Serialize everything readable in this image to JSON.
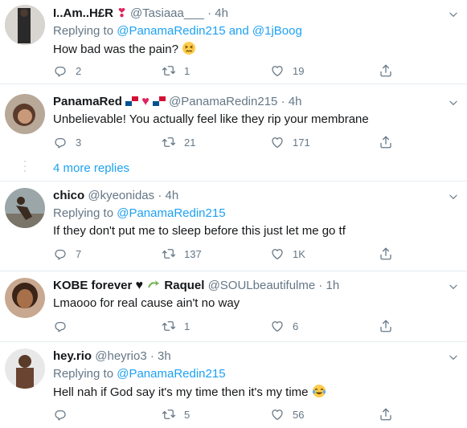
{
  "tweets": [
    {
      "name": "I..Am..H£R",
      "handle": "@Tasiaaa___",
      "time": "4h",
      "replying_prefix": "Replying to",
      "replying_to": "@PanamaRedin215 and @1jBoog",
      "text": "How bad was the pain?",
      "replies": "2",
      "retweets": "1",
      "likes": "19"
    },
    {
      "name": "PanamaRed",
      "handle": "@PanamaRedin215",
      "time": "4h",
      "text": "Unbelievable! You actually feel like they rip your membrane",
      "replies": "3",
      "retweets": "21",
      "likes": "171"
    },
    {
      "name": "chico",
      "handle": "@kyeonidas",
      "time": "4h",
      "replying_prefix": "Replying to",
      "replying_to": "@PanamaRedin215",
      "text": "If they don't put me to sleep before this just let me go tf",
      "replies": "7",
      "retweets": "137",
      "likes": "1K"
    },
    {
      "name_a": "KOBE forever",
      "name_b": "Raquel",
      "handle": "@SOULbeautifulme",
      "time": "1h",
      "text": "Lmaooo for real cause ain't no way",
      "replies": "",
      "retweets": "1",
      "likes": "6"
    },
    {
      "name": "hey.rio",
      "handle": "@heyrio3",
      "time": "3h",
      "replying_prefix": "Replying to",
      "replying_to": "@PanamaRedin215",
      "text": "Hell nah if God say it's my time then it's my time",
      "replies": "",
      "retweets": "5",
      "likes": "56"
    }
  ],
  "more_replies": "4 more replies",
  "separator": "·",
  "colors": {
    "accent": "#1da1f2",
    "muted": "#657786",
    "text": "#14171a",
    "divider": "#e6ecf0"
  }
}
